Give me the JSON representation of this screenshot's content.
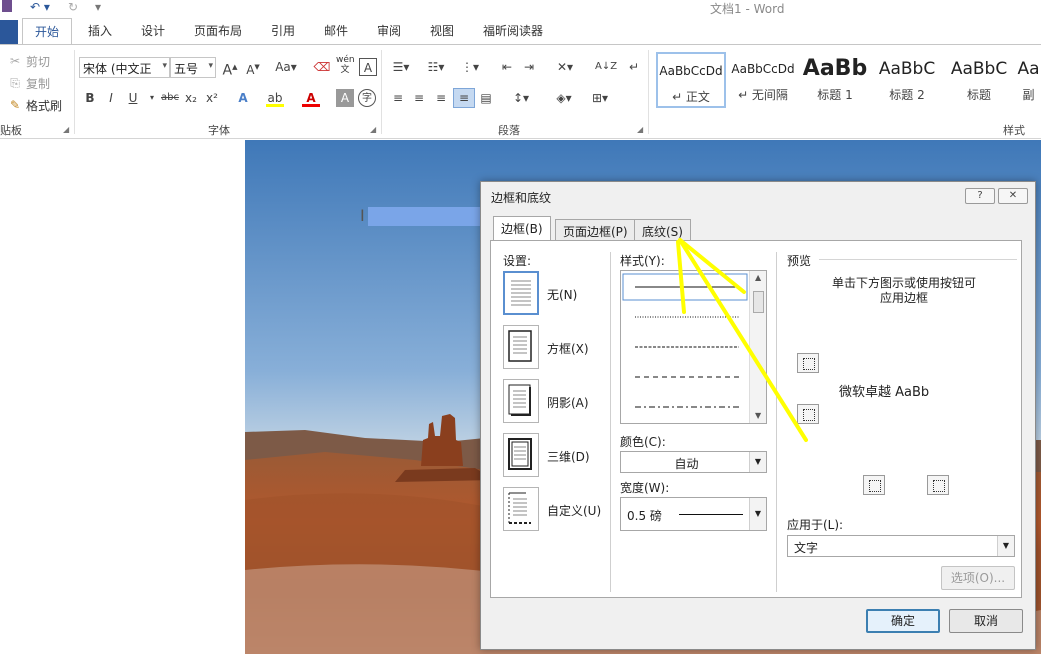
{
  "app": {
    "doc_title": "文档1 - Word"
  },
  "ribbon": {
    "tabs": [
      "开始",
      "插入",
      "设计",
      "页面布局",
      "引用",
      "邮件",
      "审阅",
      "视图",
      "福昕阅读器"
    ],
    "clipboard": {
      "cut": "剪切",
      "copy": "复制",
      "format_painter": "格式刷",
      "group": "贴板"
    },
    "font": {
      "name": "宋体 (中文正",
      "size": "五号",
      "group": "字体",
      "grow": "A",
      "shrink": "A",
      "case": "Aa",
      "wen": "wén 文",
      "bold": "B",
      "italic": "I",
      "underline": "U",
      "strike": "abc",
      "sub": "x₂",
      "sup": "x²"
    },
    "paragraph": {
      "group": "段落"
    },
    "styles": {
      "group": "样式",
      "items": [
        {
          "sample": "AaBbCcDd",
          "name": "↵ 正文"
        },
        {
          "sample": "AaBbCcDd",
          "name": "↵ 无间隔"
        },
        {
          "sample": "AaBb",
          "name": "标题 1"
        },
        {
          "sample": "AaBbC",
          "name": "标题 2"
        },
        {
          "sample": "AaBbC",
          "name": "标题"
        },
        {
          "sample": "Aa",
          "name": "副"
        }
      ]
    }
  },
  "dialog": {
    "title": "边框和底纹",
    "help": "?",
    "close": "✕",
    "tabs": [
      "边框(B)",
      "页面边框(P)",
      "底纹(S)"
    ],
    "settings_label": "设置:",
    "settings": [
      "无(N)",
      "方框(X)",
      "阴影(A)",
      "三维(D)",
      "自定义(U)"
    ],
    "style_label": "样式(Y):",
    "color_label": "颜色(C):",
    "color_value": "自动",
    "width_label": "宽度(W):",
    "width_value": "0.5 磅",
    "preview_label": "预览",
    "preview_hint_line1": "单击下方图示或使用按钮可",
    "preview_hint_line2": "应用边框",
    "preview_text": "微软卓越  AaBb",
    "apply_label": "应用于(L):",
    "apply_value": "文字",
    "options_button": "选项(O)...",
    "ok_button": "确定",
    "cancel_button": "取消"
  },
  "colors": {
    "accent": "#2b579a",
    "annotation": "#ffff00"
  }
}
